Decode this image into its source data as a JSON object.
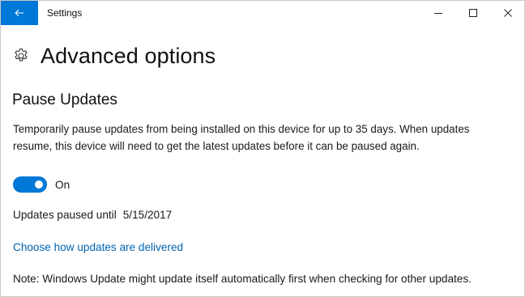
{
  "window": {
    "title": "Settings"
  },
  "page": {
    "title": "Advanced options"
  },
  "pause_updates": {
    "heading": "Pause Updates",
    "description": "Temporarily pause updates from being installed on this device for up to 35 days. When updates resume, this device will need to get the latest updates before it can be paused again.",
    "toggle_state": "On",
    "toggle_on": true,
    "paused_label": "Updates paused until",
    "paused_date": "5/15/2017"
  },
  "links": {
    "delivery": "Choose how updates are delivered"
  },
  "note": "Note: Windows Update might update itself automatically first when checking for other updates.",
  "colors": {
    "accent": "#0078d7",
    "link": "#0063b1"
  },
  "icons": {
    "back": "back-arrow-icon",
    "minimize": "minimize-icon",
    "maximize": "maximize-icon",
    "close": "close-icon",
    "page": "gear-icon"
  }
}
